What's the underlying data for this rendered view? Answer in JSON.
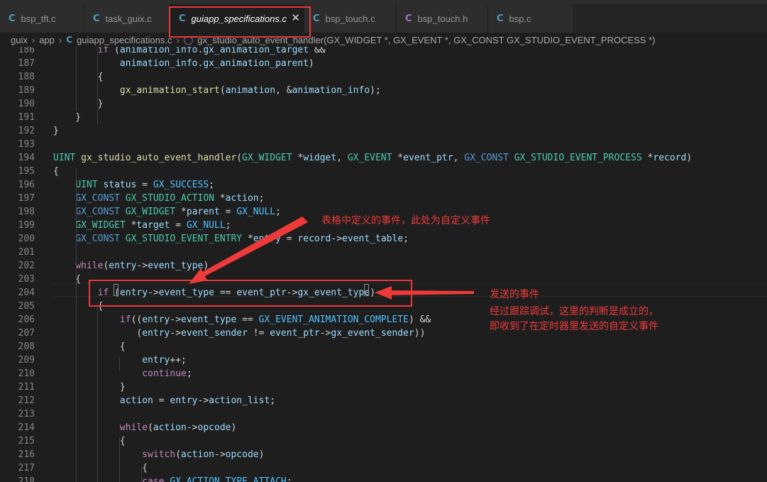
{
  "colors": {
    "keyword": "#569cd6",
    "control": "#c586c0",
    "type": "#4ec9b0",
    "function": "#dcdcaa",
    "variable": "#9cdcfe",
    "macro": "#4fc1ff",
    "text": "#d4d4d4",
    "annotation": "#ef3a3a",
    "c_icon": "#519aba",
    "h_icon": "#a074c4"
  },
  "tabs": [
    {
      "icon": "C",
      "icon_name": "c-file-icon",
      "label": "bsp_tft.c"
    },
    {
      "icon": "C",
      "icon_name": "c-file-icon",
      "label": "task_guix.c"
    },
    {
      "icon": "C",
      "icon_name": "c-file-icon",
      "label": "guiapp_specifications.c",
      "active": true,
      "close": "✕"
    },
    {
      "icon": "C",
      "icon_name": "c-file-icon",
      "label": "bsp_touch.c"
    },
    {
      "icon": "C",
      "icon_name": "h-file-icon",
      "label": "bsp_touch.h"
    },
    {
      "icon": "C",
      "icon_name": "c-file-icon",
      "label": "bsp.c"
    }
  ],
  "breadcrumb": {
    "root": "guix",
    "folder": "app",
    "file_icon": "C",
    "file": "guiapp_specifications.c",
    "symbol_icon": "cube-icon",
    "symbol": "gx_studio_auto_event_handler(GX_WIDGET *, GX_EVENT *, GX_CONST GX_STUDIO_EVENT_PROCESS *)"
  },
  "lines": [
    {
      "n": "186",
      "t": [
        [
          "        ",
          "text"
        ],
        [
          "if",
          "control"
        ],
        [
          " (",
          "text"
        ],
        [
          "animation_info",
          "variable"
        ],
        [
          ".",
          "text"
        ],
        [
          "gx_animation_target",
          "variable"
        ],
        [
          " &&",
          "text"
        ]
      ]
    },
    {
      "n": "187",
      "t": [
        [
          "            ",
          "text"
        ],
        [
          "animation_info",
          "variable"
        ],
        [
          ".",
          "text"
        ],
        [
          "gx_animation_parent",
          "variable"
        ],
        [
          ")",
          "text"
        ]
      ]
    },
    {
      "n": "188",
      "t": [
        [
          "        {",
          "text"
        ]
      ]
    },
    {
      "n": "189",
      "t": [
        [
          "            ",
          "text"
        ],
        [
          "gx_animation_start",
          "function"
        ],
        [
          "(",
          "text"
        ],
        [
          "animation",
          "variable"
        ],
        [
          ", &",
          "text"
        ],
        [
          "animation_info",
          "variable"
        ],
        [
          ");",
          "text"
        ]
      ]
    },
    {
      "n": "190",
      "t": [
        [
          "        }",
          "text"
        ]
      ]
    },
    {
      "n": "191",
      "t": [
        [
          "    }",
          "text"
        ]
      ]
    },
    {
      "n": "192",
      "t": [
        [
          "}",
          "text"
        ]
      ]
    },
    {
      "n": "193",
      "t": []
    },
    {
      "n": "194",
      "t": [
        [
          "UINT",
          "type"
        ],
        [
          " ",
          "text"
        ],
        [
          "gx_studio_auto_event_handler",
          "function"
        ],
        [
          "(",
          "text"
        ],
        [
          "GX_WIDGET",
          "type"
        ],
        [
          " *",
          "text"
        ],
        [
          "widget",
          "variable"
        ],
        [
          ", ",
          "text"
        ],
        [
          "GX_EVENT",
          "type"
        ],
        [
          " *",
          "text"
        ],
        [
          "event_ptr",
          "variable"
        ],
        [
          ", ",
          "text"
        ],
        [
          "GX_CONST",
          "keyword"
        ],
        [
          " ",
          "text"
        ],
        [
          "GX_STUDIO_EVENT_PROCESS",
          "type"
        ],
        [
          " *",
          "text"
        ],
        [
          "record",
          "variable"
        ],
        [
          ")",
          "text"
        ]
      ]
    },
    {
      "n": "195",
      "t": [
        [
          "{",
          "text"
        ]
      ]
    },
    {
      "n": "196",
      "t": [
        [
          "    ",
          "text"
        ],
        [
          "UINT",
          "type"
        ],
        [
          " ",
          "text"
        ],
        [
          "status",
          "variable"
        ],
        [
          " = ",
          "text"
        ],
        [
          "GX_SUCCESS",
          "macro"
        ],
        [
          ";",
          "text"
        ]
      ]
    },
    {
      "n": "197",
      "t": [
        [
          "    ",
          "text"
        ],
        [
          "GX_CONST",
          "keyword"
        ],
        [
          " ",
          "text"
        ],
        [
          "GX_STUDIO_ACTION",
          "type"
        ],
        [
          " *",
          "text"
        ],
        [
          "action",
          "variable"
        ],
        [
          ";",
          "text"
        ]
      ]
    },
    {
      "n": "198",
      "t": [
        [
          "    ",
          "text"
        ],
        [
          "GX_CONST",
          "keyword"
        ],
        [
          " ",
          "text"
        ],
        [
          "GX_WIDGET",
          "type"
        ],
        [
          " *",
          "text"
        ],
        [
          "parent",
          "variable"
        ],
        [
          " = ",
          "text"
        ],
        [
          "GX_NULL",
          "macro"
        ],
        [
          ";",
          "text"
        ]
      ]
    },
    {
      "n": "199",
      "t": [
        [
          "    ",
          "text"
        ],
        [
          "GX_WIDGET",
          "type"
        ],
        [
          " *",
          "text"
        ],
        [
          "target",
          "variable"
        ],
        [
          " = ",
          "text"
        ],
        [
          "GX_NULL",
          "macro"
        ],
        [
          ";",
          "text"
        ]
      ]
    },
    {
      "n": "200",
      "t": [
        [
          "    ",
          "text"
        ],
        [
          "GX_CONST",
          "keyword"
        ],
        [
          " ",
          "text"
        ],
        [
          "GX_STUDIO_EVENT_ENTRY",
          "type"
        ],
        [
          " *",
          "text"
        ],
        [
          "entry",
          "variable"
        ],
        [
          " = ",
          "text"
        ],
        [
          "record",
          "variable"
        ],
        [
          "->",
          "text"
        ],
        [
          "event_table",
          "variable"
        ],
        [
          ";",
          "text"
        ]
      ]
    },
    {
      "n": "201",
      "t": []
    },
    {
      "n": "202",
      "t": [
        [
          "    ",
          "text"
        ],
        [
          "while",
          "control"
        ],
        [
          "(",
          "text"
        ],
        [
          "entry",
          "variable"
        ],
        [
          "->",
          "text"
        ],
        [
          "event_type",
          "variable"
        ],
        [
          ")",
          "text"
        ]
      ]
    },
    {
      "n": "203",
      "t": [
        [
          "    {",
          "text"
        ]
      ]
    },
    {
      "n": "204",
      "t": [
        [
          "        ",
          "text"
        ],
        [
          "if",
          "control"
        ],
        [
          " (",
          "text"
        ],
        [
          "entry",
          "variable"
        ],
        [
          "->",
          "text"
        ],
        [
          "event_type",
          "variable"
        ],
        [
          " == ",
          "text"
        ],
        [
          "event_ptr",
          "variable"
        ],
        [
          "->",
          "text"
        ],
        [
          "gx_event_type",
          "variable"
        ],
        [
          ")",
          "text"
        ]
      ]
    },
    {
      "n": "205",
      "t": [
        [
          "        {",
          "text"
        ]
      ]
    },
    {
      "n": "206",
      "t": [
        [
          "            ",
          "text"
        ],
        [
          "if",
          "control"
        ],
        [
          "((",
          "text"
        ],
        [
          "entry",
          "variable"
        ],
        [
          "->",
          "text"
        ],
        [
          "event_type",
          "variable"
        ],
        [
          " == ",
          "text"
        ],
        [
          "GX_EVENT_ANIMATION_COMPLETE",
          "macro"
        ],
        [
          ") &&",
          "text"
        ]
      ]
    },
    {
      "n": "207",
      "t": [
        [
          "               (",
          "text"
        ],
        [
          "entry",
          "variable"
        ],
        [
          "->",
          "text"
        ],
        [
          "event_sender",
          "variable"
        ],
        [
          " != ",
          "text"
        ],
        [
          "event_ptr",
          "variable"
        ],
        [
          "->",
          "text"
        ],
        [
          "gx_event_sender",
          "variable"
        ],
        [
          "))",
          "text"
        ]
      ]
    },
    {
      "n": "208",
      "t": [
        [
          "            {",
          "text"
        ]
      ]
    },
    {
      "n": "209",
      "t": [
        [
          "                ",
          "text"
        ],
        [
          "entry",
          "variable"
        ],
        [
          "++;",
          "text"
        ]
      ]
    },
    {
      "n": "210",
      "t": [
        [
          "                ",
          "text"
        ],
        [
          "continue",
          "control"
        ],
        [
          ";",
          "text"
        ]
      ]
    },
    {
      "n": "211",
      "t": [
        [
          "            }",
          "text"
        ]
      ]
    },
    {
      "n": "212",
      "t": [
        [
          "            ",
          "text"
        ],
        [
          "action",
          "variable"
        ],
        [
          " = ",
          "text"
        ],
        [
          "entry",
          "variable"
        ],
        [
          "->",
          "text"
        ],
        [
          "action_list",
          "variable"
        ],
        [
          ";",
          "text"
        ]
      ]
    },
    {
      "n": "213",
      "t": []
    },
    {
      "n": "214",
      "t": [
        [
          "            ",
          "text"
        ],
        [
          "while",
          "control"
        ],
        [
          "(",
          "text"
        ],
        [
          "action",
          "variable"
        ],
        [
          "->",
          "text"
        ],
        [
          "opcode",
          "variable"
        ],
        [
          ")",
          "text"
        ]
      ]
    },
    {
      "n": "215",
      "t": [
        [
          "            {",
          "text"
        ]
      ]
    },
    {
      "n": "216",
      "t": [
        [
          "                ",
          "text"
        ],
        [
          "switch",
          "control"
        ],
        [
          "(",
          "text"
        ],
        [
          "action",
          "variable"
        ],
        [
          "->",
          "text"
        ],
        [
          "opcode",
          "variable"
        ],
        [
          ")",
          "text"
        ]
      ]
    },
    {
      "n": "217",
      "t": [
        [
          "                {",
          "text"
        ]
      ]
    },
    {
      "n": "218",
      "t": [
        [
          "                ",
          "text"
        ],
        [
          "case",
          "control"
        ],
        [
          " ",
          "text"
        ],
        [
          "GX_ACTION_TYPE_ATTACH",
          "macro"
        ],
        [
          ":",
          "text"
        ]
      ]
    }
  ],
  "annotations": {
    "table_event": "表格中定义的事件，此处为自定义事件",
    "sent_event": "发送的事件",
    "debug_line1": "经过跟踪调试，这里的判断是成立的，",
    "debug_line2": "即收到了在定时器里发送的自定义事件"
  }
}
